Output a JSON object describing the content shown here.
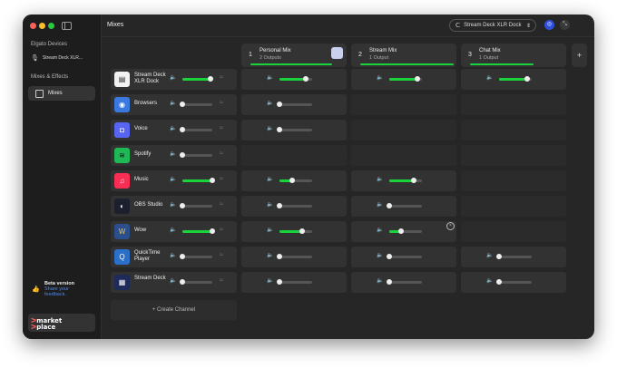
{
  "topbar": {
    "title": "Mixes",
    "device": "Stream Deck XLR Dock"
  },
  "sidebar": {
    "devices_title": "Elgato Devices",
    "device": "Stream Deck XLR...",
    "mixes_title": "Mixes & Effects",
    "mixes_item": "Mixes",
    "beta_title": "Beta version",
    "beta_link1": "Share your",
    "beta_link2": "feedback."
  },
  "logo_text": "marketplace",
  "mixes": [
    {
      "num": "1",
      "name": "Personal Mix",
      "outputs": "2 Outputs"
    },
    {
      "num": "2",
      "name": "Stream Mix",
      "outputs": "1 Output"
    },
    {
      "num": "3",
      "name": "Chat Mix",
      "outputs": "1 Output"
    }
  ],
  "add_mix": "+",
  "channels": [
    {
      "name": "Stream Deck XLR Dock",
      "icon": "xlr-dock-icon",
      "color": "#f2f2f2",
      "fg": "#222",
      "glyph": "▤",
      "main": 0.95,
      "cells": [
        0.8,
        0.85,
        0.85
      ]
    },
    {
      "name": "Browsers",
      "icon": "browsers-icon",
      "color": "#3a7ae0",
      "fg": "#fff",
      "glyph": "◉",
      "main": 0.0,
      "cells": [
        0.0,
        null,
        null
      ]
    },
    {
      "name": "Voice",
      "icon": "voice-icon",
      "color": "#5865f2",
      "fg": "#fff",
      "glyph": "◘",
      "main": 0.0,
      "cells": [
        0.0,
        null,
        null
      ]
    },
    {
      "name": "Spotify",
      "icon": "spotify-icon",
      "color": "#1db954",
      "fg": "#111",
      "glyph": "≋",
      "main": 0.0,
      "cells": [
        null,
        null,
        null
      ]
    },
    {
      "name": "Music",
      "icon": "music-icon",
      "color": "#fa2d55",
      "fg": "#fff",
      "glyph": "♫",
      "main": 1.0,
      "cells": [
        0.4,
        0.75,
        null
      ]
    },
    {
      "name": "OBS Studio",
      "icon": "obs-icon",
      "color": "#1c1f2e",
      "fg": "#fff",
      "glyph": "◐",
      "main": 0.0,
      "cells": [
        0.0,
        0.0,
        null
      ]
    },
    {
      "name": "Wow",
      "icon": "wow-icon",
      "color": "#2b4f8c",
      "fg": "#f5c542",
      "glyph": "W",
      "main": 1.0,
      "cells": [
        0.7,
        0.35,
        null
      ]
    },
    {
      "name": "QuickTime Player",
      "icon": "quicktime-icon",
      "color": "#2a6fc9",
      "fg": "#fff",
      "glyph": "Q",
      "main": 0.0,
      "cells": [
        0.0,
        0.0,
        0.0
      ]
    },
    {
      "name": "Stream Deck",
      "icon": "stream-deck-icon",
      "color": "#1e2a5a",
      "fg": "#fff",
      "glyph": "▦",
      "main": 0.0,
      "cells": [
        0.0,
        0.0,
        0.0
      ]
    }
  ],
  "create_channel": "+   Create Channel",
  "colors": {
    "accent": "#19d23c",
    "link": "#4d8af0"
  }
}
